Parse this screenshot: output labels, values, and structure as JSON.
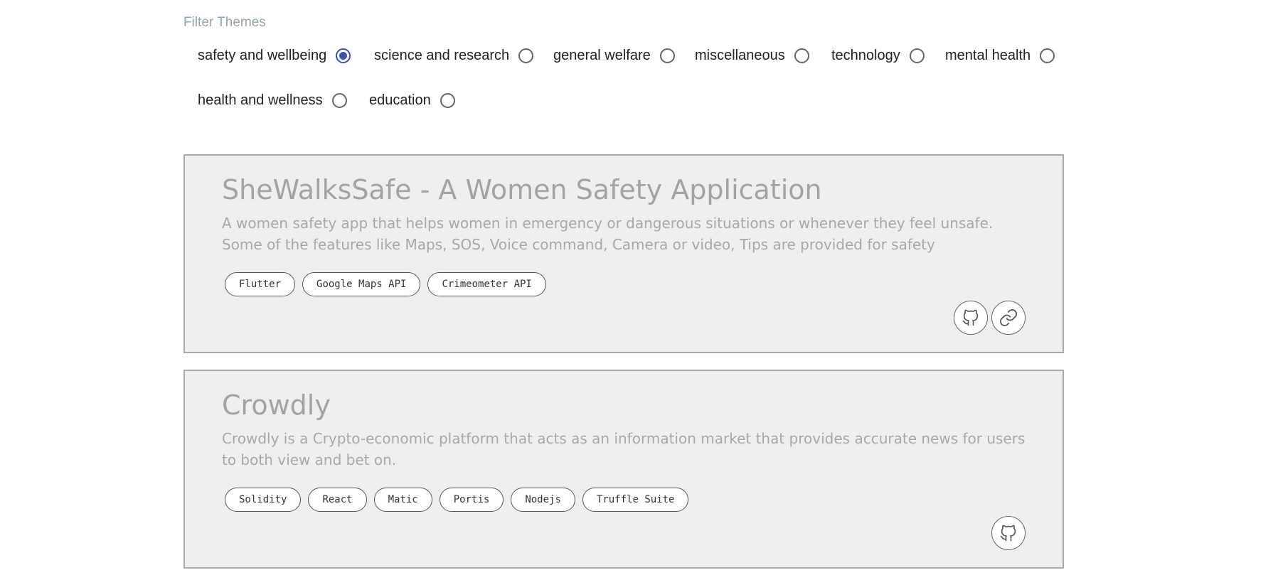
{
  "filter": {
    "title": "Filter Themes",
    "options": [
      {
        "label": "safety and wellbeing",
        "checked": true
      },
      {
        "label": "science and research",
        "checked": false
      },
      {
        "label": "general welfare",
        "checked": false
      },
      {
        "label": "miscellaneous",
        "checked": false
      },
      {
        "label": "technology",
        "checked": false
      },
      {
        "label": "mental health",
        "checked": false
      },
      {
        "label": "health and wellness",
        "checked": false
      },
      {
        "label": "education",
        "checked": false
      }
    ]
  },
  "projects": [
    {
      "title": "SheWalksSafe - A Women Safety Application",
      "description": "A women safety app that helps women in emergency or dangerous situations or whenever they feel unsafe. Some of the features like Maps, SOS, Voice command, Camera or video, Tips are provided for safety",
      "tags": [
        "Flutter",
        "Google Maps API",
        "Crimeometer API"
      ],
      "links": [
        "github-icon",
        "link-icon"
      ]
    },
    {
      "title": "Crowdly",
      "description": "Crowdly is a Crypto-economic platform that acts as an information market that provides accurate news for users to both view and bet on.",
      "tags": [
        "Solidity",
        "React",
        "Matic",
        "Portis",
        "Nodejs",
        "Truffle Suite"
      ],
      "links": [
        "github-icon"
      ]
    }
  ],
  "colors": {
    "accent": "#3f51b5",
    "card_bg": "#efefef",
    "card_border": "#a9a9a9",
    "muted_text": "#a3a3a3"
  }
}
